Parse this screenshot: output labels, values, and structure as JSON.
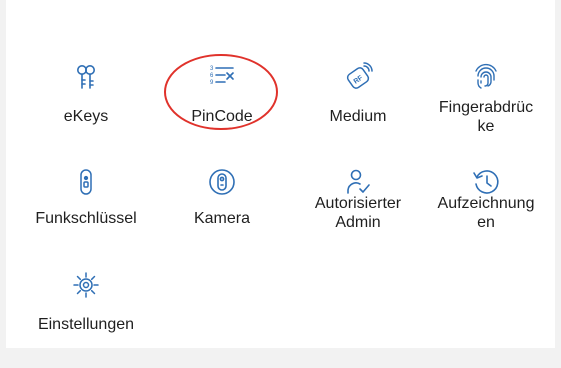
{
  "tiles": [
    {
      "label": "eKeys",
      "icon": "key-icon"
    },
    {
      "label": "PinCode",
      "icon": "pincode-list-icon"
    },
    {
      "label": "Medium",
      "icon": "rfid-tag-icon"
    },
    {
      "label": "Fingerabdrüc\nke",
      "icon": "fingerprint-icon"
    },
    {
      "label": "Funkschlüssel",
      "icon": "remote-fob-icon"
    },
    {
      "label": "Kamera",
      "icon": "camera-icon"
    },
    {
      "label": "Autorisierter\nAdmin",
      "icon": "admin-user-icon"
    },
    {
      "label": "Aufzeichnung\nen",
      "icon": "history-icon"
    },
    {
      "label": "Einstellungen",
      "icon": "gear-icon"
    }
  ],
  "accent": "#2f6fb5",
  "highlight_color": "#e0322b"
}
